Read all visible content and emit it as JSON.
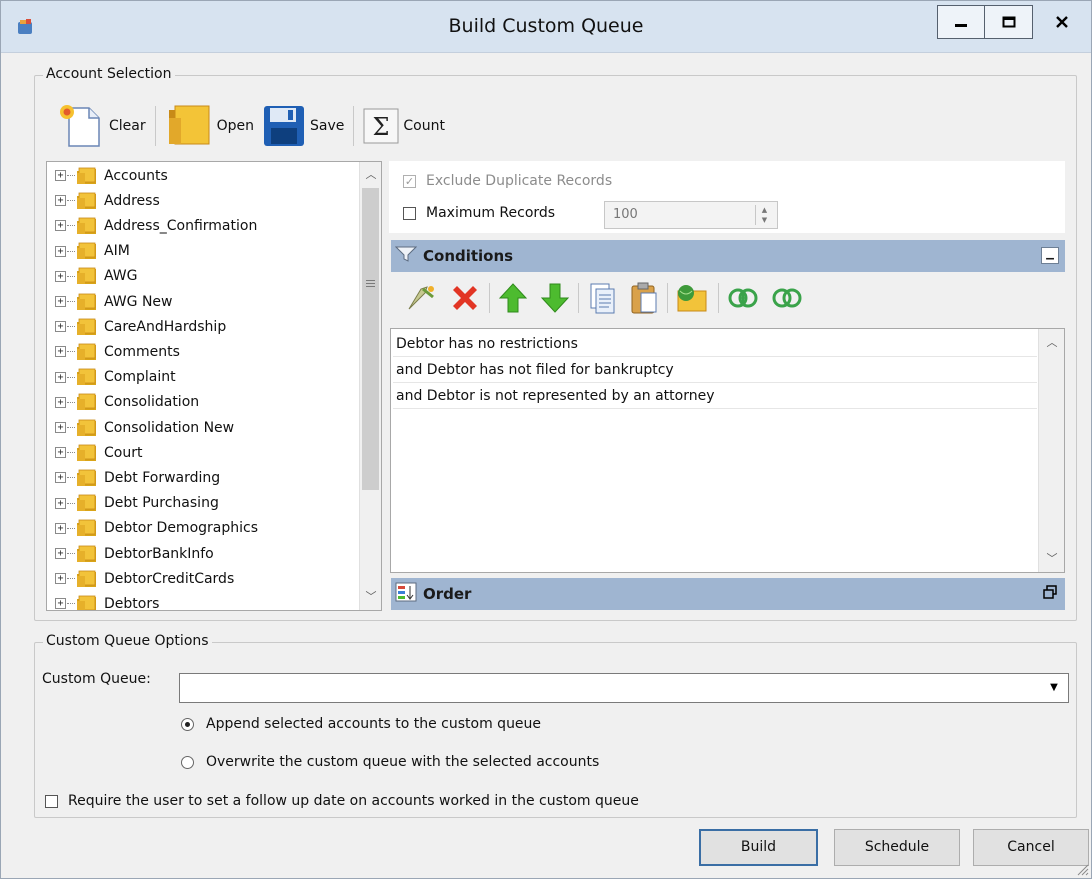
{
  "window": {
    "title": "Build Custom Queue",
    "minimize_glyph": "▁",
    "maximize_glyph": "□",
    "close_glyph": "x"
  },
  "account_selection": {
    "legend": "Account Selection",
    "toolbar": {
      "clear": "Clear",
      "open": "Open",
      "save": "Save",
      "count": "Count"
    },
    "tree_items": [
      "Accounts",
      "Address",
      "Address_Confirmation",
      "AIM",
      "AWG",
      "AWG New",
      "CareAndHardship",
      "Comments",
      "Complaint",
      "Consolidation",
      "Consolidation New",
      "Court",
      "Debt Forwarding",
      "Debt Purchasing",
      "Debtor Demographics",
      "DebtorBankInfo",
      "DebtorCreditCards",
      "Debtors"
    ],
    "exclude_duplicates": {
      "label": "Exclude Duplicate Records",
      "checked": true,
      "enabled": false
    },
    "maximum_records": {
      "label": "Maximum Records",
      "checked": false,
      "value": "100"
    },
    "conditions_title": "Conditions",
    "conditions": [
      "Debtor has no restrictions",
      "and Debtor has not filed for bankruptcy",
      "and Debtor is not represented by an attorney"
    ],
    "order_title": "Order"
  },
  "custom_queue_options": {
    "legend": "Custom Queue Options",
    "custom_queue_label": "Custom Queue:",
    "custom_queue_value": "",
    "append_option": "Append selected accounts to the custom queue",
    "overwrite_option": "Overwrite the custom queue with the selected accounts",
    "selected_option": "append"
  },
  "follow_up": {
    "label": "Require the user to set a follow up date on accounts worked in the custom queue",
    "checked": false
  },
  "buttons": {
    "build": "Build",
    "schedule": "Schedule",
    "cancel": "Cancel"
  },
  "colors": {
    "section_bar": "#9fb5d1",
    "titlebar": "#d7e3f0",
    "folder": "#f2c33a"
  }
}
